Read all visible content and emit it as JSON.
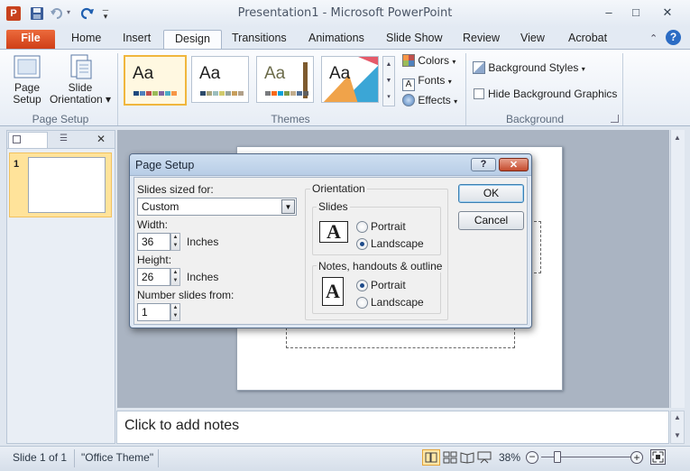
{
  "window": {
    "title": "Presentation1 - Microsoft PowerPoint",
    "app_icon_letter": "P",
    "controls": {
      "minimize": "–",
      "restore": "□",
      "close": "✕"
    }
  },
  "tabs": [
    "File",
    "Home",
    "Insert",
    "Design",
    "Transitions",
    "Animations",
    "Slide Show",
    "Review",
    "View",
    "Acrobat"
  ],
  "active_tab": "Design",
  "ribbon": {
    "page_setup_group": {
      "label": "Page Setup",
      "page_setup_btn": [
        "Page",
        "Setup"
      ],
      "orientation_btn": [
        "Slide",
        "Orientation ▾"
      ]
    },
    "themes_group": {
      "label": "Themes",
      "theme_sample": "Aa",
      "colors": "Colors",
      "fonts": "Fonts",
      "effects": "Effects"
    },
    "background_group": {
      "label": "Background",
      "styles": "Background Styles",
      "hide": "Hide Background Graphics"
    }
  },
  "slides_pane": {
    "slide_number": "1"
  },
  "notes": {
    "placeholder": "Click to add notes"
  },
  "status": {
    "slide": "Slide 1 of 1",
    "theme": "\"Office Theme\"",
    "zoom": "38%"
  },
  "dialog": {
    "title": "Page Setup",
    "help": "?",
    "sized_for_label": "Slides sized for:",
    "sized_for_value": "Custom",
    "width_label": "Width:",
    "width_value": "36",
    "width_unit": "Inches",
    "height_label": "Height:",
    "height_value": "26",
    "height_unit": "Inches",
    "number_from_label": "Number slides from:",
    "number_from_value": "1",
    "orientation_label": "Orientation",
    "slides_label": "Slides",
    "slides_portrait": "Portrait",
    "slides_landscape": "Landscape",
    "notes_label": "Notes, handouts & outline",
    "notes_portrait": "Portrait",
    "notes_landscape": "Landscape",
    "ok": "OK",
    "cancel": "Cancel"
  },
  "colors": {
    "file_tab": "#d9431d",
    "accent": "#1d4a8a",
    "thumb_highlight": "#ffe39a"
  }
}
